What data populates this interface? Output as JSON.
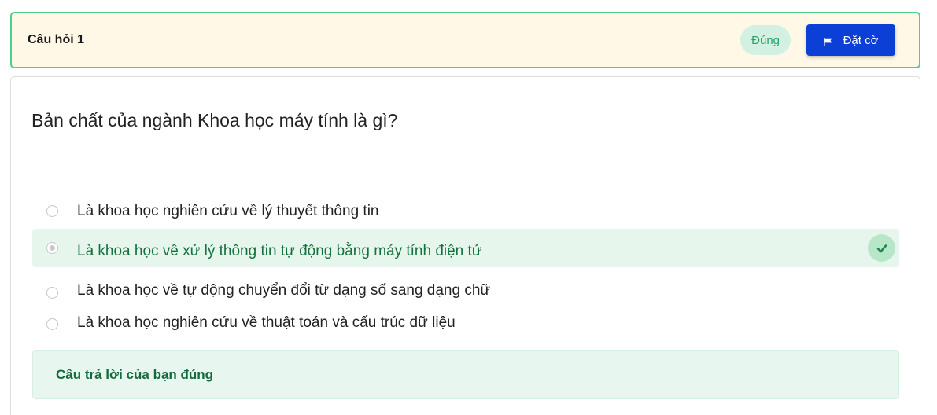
{
  "question": {
    "header_title": "Câu hỏi 1",
    "status_label": "Đúng",
    "flag_button_label": "Đặt cờ",
    "text": "Bản chất của ngành Khoa học máy tính là gì?",
    "options": [
      {
        "label": "Là khoa học nghiên cứu về lý thuyết thông tin",
        "selected": false,
        "correct": false
      },
      {
        "label": "Là khoa học về xử lý thông tin tự động bằng máy tính điện tử",
        "selected": true,
        "correct": true
      },
      {
        "label": "Là khoa học về tự động chuyển đổi từ dạng số sang dạng chữ",
        "selected": false,
        "correct": false
      },
      {
        "label": "Là khoa học nghiên cứu về thuật toán và cấu trúc dữ liệu",
        "selected": false,
        "correct": false
      }
    ],
    "feedback": "Câu trả lời của bạn đúng"
  },
  "icons": {
    "flag": "flag-icon",
    "check": "check-icon"
  },
  "colors": {
    "header_bg": "#fff8e6",
    "header_border": "#4cd08a",
    "primary_button": "#0b3fd6",
    "correct_bg": "#e6f6ec",
    "correct_text": "#15723f",
    "status_badge_bg": "#d3f1e2"
  }
}
